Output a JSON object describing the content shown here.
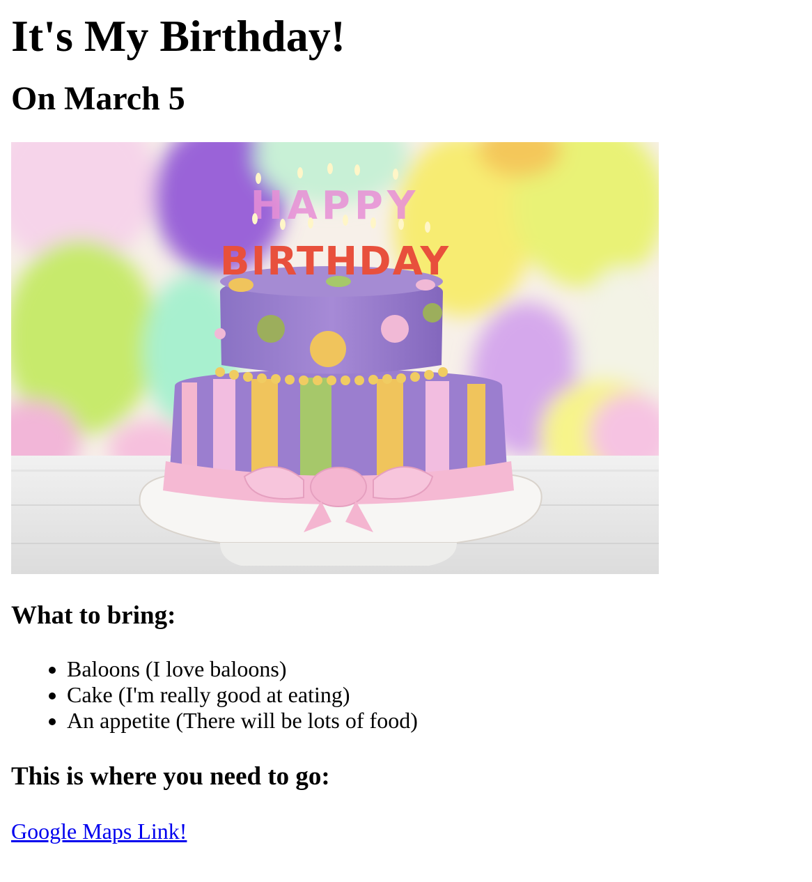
{
  "page": {
    "title": "It's My Birthday!",
    "subtitle": "On March 5"
  },
  "image": {
    "cake_letters_top": "HAPPY",
    "cake_letters_bottom": "BIRTHDAY"
  },
  "bring": {
    "heading": "What to bring:",
    "items": [
      "Baloons (I love baloons)",
      "Cake (I'm really good at eating)",
      "An appetite (There will be lots of food)"
    ]
  },
  "directions": {
    "heading": "This is where you need to go:",
    "link_text": "Google Maps Link!"
  },
  "colors": {
    "link": "#0000ee",
    "text": "#000000",
    "background": "#ffffff"
  }
}
